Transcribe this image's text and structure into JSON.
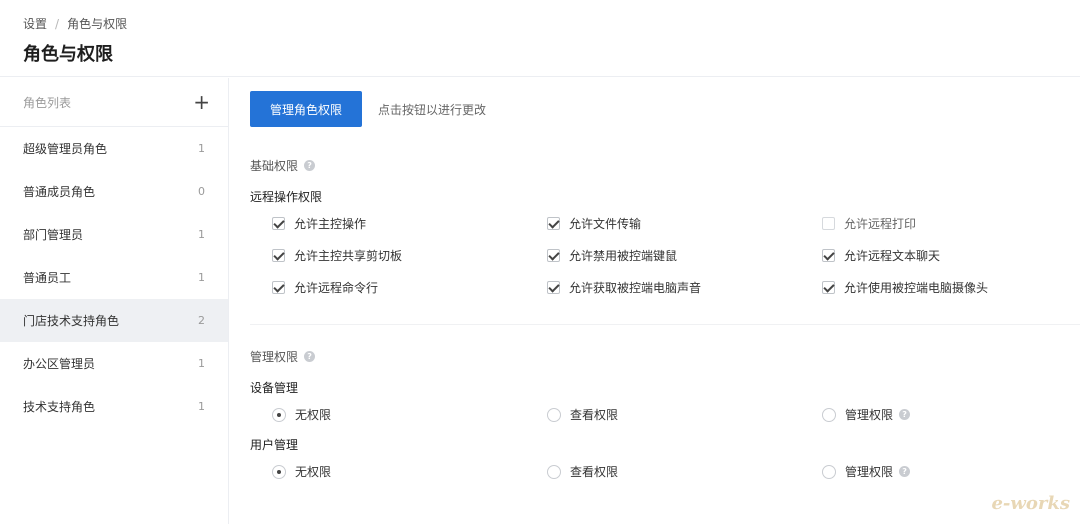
{
  "breadcrumb": {
    "root": "设置",
    "separator": "/",
    "current": "角色与权限"
  },
  "page_title": "角色与权限",
  "sidebar": {
    "header_label": "角色列表",
    "add_icon": "+",
    "roles": [
      {
        "name": "超级管理员角色",
        "count": "1",
        "active": false
      },
      {
        "name": "普通成员角色",
        "count": "0",
        "active": false
      },
      {
        "name": "部门管理员",
        "count": "1",
        "active": false
      },
      {
        "name": "普通员工",
        "count": "1",
        "active": false
      },
      {
        "name": "门店技术支持角色",
        "count": "2",
        "active": true
      },
      {
        "name": "办公区管理员",
        "count": "1",
        "active": false
      },
      {
        "name": "技术支持角色",
        "count": "1",
        "active": false
      }
    ]
  },
  "toolbar": {
    "manage_button": "管理角色权限",
    "hint": "点击按钮以进行更改"
  },
  "basic_permissions": {
    "title": "基础权限",
    "remote_ops": {
      "title": "远程操作权限",
      "options": [
        {
          "label": "允许主控操作",
          "checked": true
        },
        {
          "label": "允许文件传输",
          "checked": true
        },
        {
          "label": "允许远程打印",
          "checked": false
        },
        {
          "label": "允许主控共享剪切板",
          "checked": true
        },
        {
          "label": "允许禁用被控端键鼠",
          "checked": true
        },
        {
          "label": "允许远程文本聊天",
          "checked": true
        },
        {
          "label": "允许远程命令行",
          "checked": true
        },
        {
          "label": "允许获取被控端电脑声音",
          "checked": true
        },
        {
          "label": "允许使用被控端电脑摄像头",
          "checked": true
        }
      ]
    }
  },
  "manage_permissions": {
    "title": "管理权限",
    "device": {
      "title": "设备管理",
      "options": [
        {
          "label": "无权限",
          "selected": true
        },
        {
          "label": "查看权限",
          "selected": false
        },
        {
          "label": "管理权限",
          "selected": false
        }
      ]
    },
    "user": {
      "title": "用户管理",
      "options": [
        {
          "label": "无权限",
          "selected": true
        },
        {
          "label": "查看权限",
          "selected": false
        },
        {
          "label": "管理权限",
          "selected": false
        }
      ]
    }
  },
  "watermark": "e-works"
}
